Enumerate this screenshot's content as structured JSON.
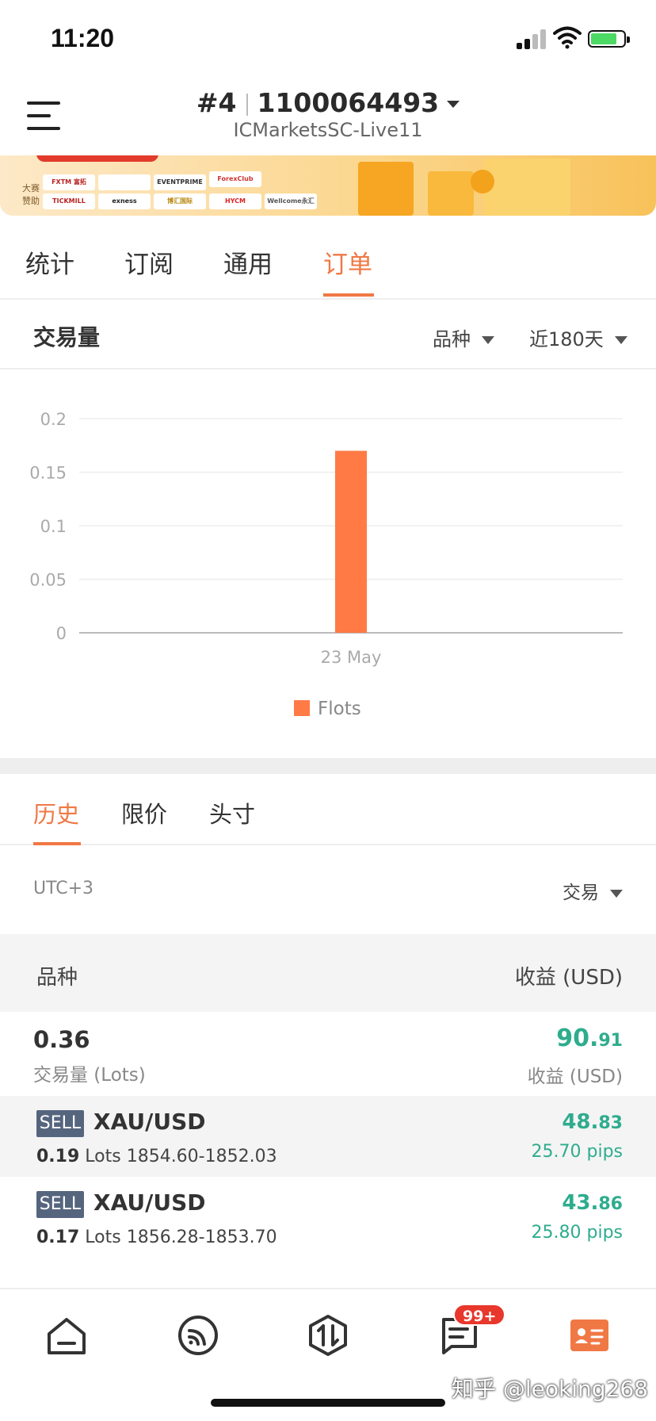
{
  "status_bar": {
    "time": "11:20"
  },
  "header": {
    "account_rank": "#4",
    "account_number": "1100064493",
    "server": "ICMarketsSC-Live11"
  },
  "banner": {
    "sponsor_label": "大赛赞助",
    "logos": [
      "FXTM 富拓",
      "",
      "EVENTPRIME",
      "ForexClub",
      "TICKMILL",
      "exness",
      "博汇国际",
      "HYCM",
      "Wellcome永汇"
    ]
  },
  "tabs": [
    "统计",
    "订阅",
    "通用",
    "订单"
  ],
  "active_tab": "订单",
  "volume_section": {
    "title": "交易量",
    "symbol_filter": "品种",
    "period_filter": "近180天"
  },
  "chart_data": {
    "type": "bar",
    "categories": [
      "23 May"
    ],
    "series": [
      {
        "name": "Flots",
        "values": [
          0.17
        ],
        "color": "#ff7a45"
      }
    ],
    "ylim": [
      0,
      0.2
    ],
    "yticks": [
      "0",
      "0.05",
      "0.1",
      "0.15",
      "0.2"
    ],
    "grid": true,
    "legend_position": "bottom"
  },
  "sub_tabs": [
    "历史",
    "限价",
    "头寸"
  ],
  "active_sub_tab": "历史",
  "timezone": "UTC+3",
  "trade_filter": "交易",
  "table_header": {
    "left": "品种",
    "right": "收益 (USD)"
  },
  "summary": {
    "lots": "0.36",
    "lots_label": "交易量 (Lots)",
    "profit_int": "90.",
    "profit_dec": "91",
    "profit_label": "收益 (USD)"
  },
  "orders": [
    {
      "side": "SELL",
      "symbol": "XAU/USD",
      "lots": "0.19",
      "lots_unit": "Lots",
      "prices": "1854.60-1852.03",
      "profit_int": "48.",
      "profit_dec": "83",
      "pips": "25.70 pips"
    },
    {
      "side": "SELL",
      "symbol": "XAU/USD",
      "lots": "0.17",
      "lots_unit": "Lots",
      "prices": "1856.28-1853.70",
      "profit_int": "43.",
      "profit_dec": "86",
      "pips": "25.80 pips"
    }
  ],
  "bottom_nav": {
    "items": [
      "home-icon",
      "feed-icon",
      "trade-icon",
      "message-icon",
      "profile-card-icon"
    ],
    "message_badge": "99+",
    "accent": "#f07845"
  },
  "watermark": "知乎 @leoking268",
  "colors": {
    "accent": "#f07845",
    "profit": "#2eac8e",
    "sell_badge": "#56657e"
  }
}
